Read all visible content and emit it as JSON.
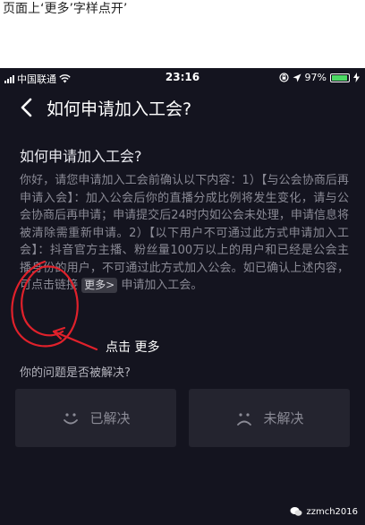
{
  "caption": "页面上‘更多’字样点开’",
  "status_bar": {
    "carrier": "中国联通",
    "time": "23:16",
    "battery": "97%",
    "battery_level": 0.97
  },
  "nav": {
    "title": "如何申请加入工会?"
  },
  "content": {
    "question": "如何申请加入工会?",
    "body_text": "你好，请您申请加入工会前确认以下内容：1）【与公会协商后再申请入会】：加入公会后你的直播分成比例将发生变化，请与公会协商后再申请；申请提交后24时内如公会未处理，申请信息将被清除需重新申请。2）【以下用户不可通过此方式申请加入工会】：抖音官方主播、粉丝量100万以上的用户和已经是公会主播身份的用户，不可通过此方式加入公会。如已确认上述内容，可点击链接",
    "more_link": "更多>",
    "body_tail": "申请加入工会。"
  },
  "feedback": {
    "question": "你的问题是否被解决?",
    "solved": "已解决",
    "unsolved": "未解决"
  },
  "annotation": {
    "label": "点击 更多",
    "color": "#e0212b"
  },
  "watermark": "zzmch2016"
}
